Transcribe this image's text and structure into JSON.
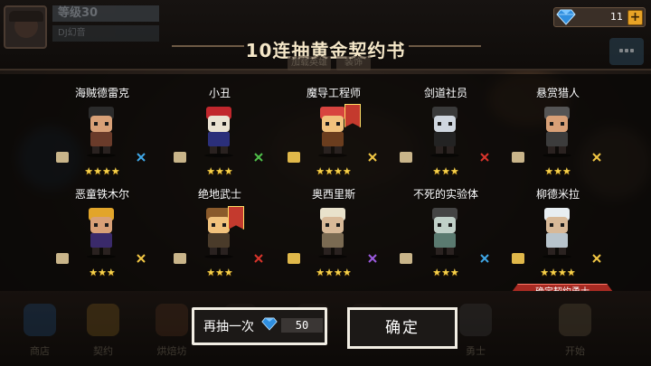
{
  "header": {
    "level": "等级30",
    "subtitle": "DJ幻音",
    "gems": "11",
    "plus": "+"
  },
  "dialog": {
    "title": "10连抽黄金契约书",
    "faded_tabs": [
      "加载英雄",
      "装饰"
    ]
  },
  "heroes": [
    {
      "name": "海贼德雷克",
      "stars": "★★★★",
      "weapon": "gem-icon",
      "weapon_color": "#3fa7e6"
    },
    {
      "name": "小丑",
      "stars": "★★★",
      "weapon": "shuriken-icon",
      "weapon_color": "#4fbf4a"
    },
    {
      "name": "魔导工程师",
      "stars": "★★★★",
      "weapon": "wand-icon",
      "weapon_color": "#f2c744"
    },
    {
      "name": "剑道社员",
      "stars": "★★★",
      "weapon": "crossed-swords-icon",
      "weapon_color": "#d9342b"
    },
    {
      "name": "悬赏猎人",
      "stars": "★★★",
      "weapon": "rifle-icon",
      "weapon_color": "#f2c744"
    },
    {
      "name": "恶童铁木尔",
      "stars": "★★★",
      "weapon": "staff-icon",
      "weapon_color": "#f2c744"
    },
    {
      "name": "绝地武士",
      "stars": "★★★",
      "weapon": "crossed-swords-icon",
      "weapon_color": "#d9342b"
    },
    {
      "name": "奥西里斯",
      "stars": "★★★★",
      "weapon": "magic-staff-icon",
      "weapon_color": "#9c5be0"
    },
    {
      "name": "不死的实验体",
      "stars": "★★★",
      "weapon": "gem-icon",
      "weapon_color": "#3fa7e6"
    },
    {
      "name": "柳德米拉",
      "stars": "★★★★",
      "weapon": "rifle-icon",
      "weapon_color": "#f2c744"
    }
  ],
  "confirm_ribbon": "确定契约勇士",
  "actions": {
    "draw_again": "再抽一次",
    "draw_again_cost": "50",
    "confirm": "确定"
  },
  "nav": [
    {
      "label": "商店",
      "icon": "shop-gem-icon"
    },
    {
      "label": "契约",
      "icon": "contract-icon"
    },
    {
      "label": "烘焙坊",
      "icon": "bakery-icon"
    },
    {
      "label": "",
      "icon": "blank"
    },
    {
      "label": "",
      "icon": "blank"
    },
    {
      "label": "",
      "icon": "blank"
    },
    {
      "label": "勇士",
      "icon": "warrior-icon"
    },
    {
      "label": "开始",
      "icon": "start-icon"
    }
  ],
  "colors": {
    "gold_star": "#f7d14a",
    "gem_blue": "#2f8fe0",
    "ribbon_red": "#a72a22",
    "plus_orange": "#e8a326"
  }
}
